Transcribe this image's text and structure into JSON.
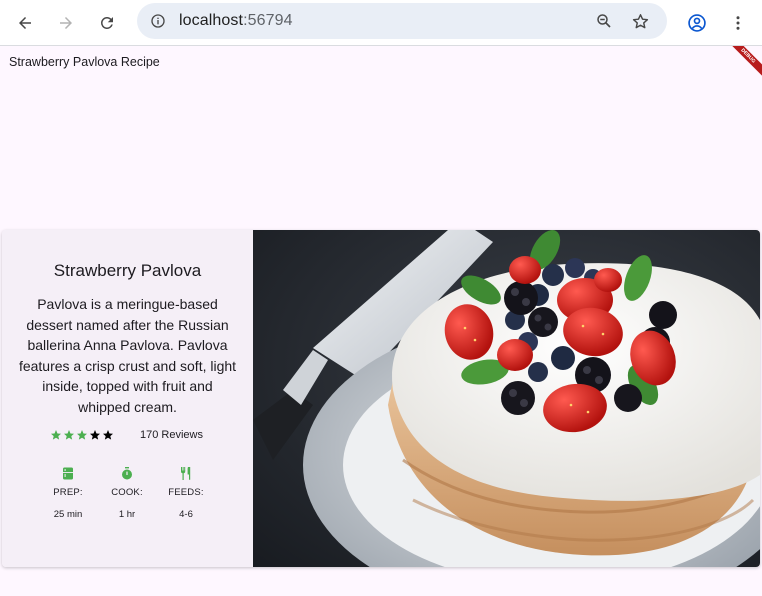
{
  "browser": {
    "url_host": "localhost",
    "url_port": ":56794"
  },
  "app": {
    "title": "Strawberry Pavlova Recipe",
    "debug_banner": "DEBUG"
  },
  "recipe": {
    "title": "Strawberry Pavlova",
    "description": "Pavlova is a meringue-based dessert named after the Russian ballerina Anna Pavlova. Pavlova features a crisp crust and soft, light inside, topped with fruit and whipped cream.",
    "rating": 3,
    "rating_max": 5,
    "reviews": "170 Reviews",
    "star_color_filled": "#4caf50",
    "star_color_empty": "#000000",
    "info": [
      {
        "icon": "kitchen-icon",
        "label": "PREP:",
        "value": "25 min"
      },
      {
        "icon": "timer-icon",
        "label": "COOK:",
        "value": "1 hr"
      },
      {
        "icon": "restaurant-icon",
        "label": "FEEDS:",
        "value": "4-6"
      }
    ],
    "icon_color": "#4caf50",
    "image": "pavlova-photo"
  }
}
